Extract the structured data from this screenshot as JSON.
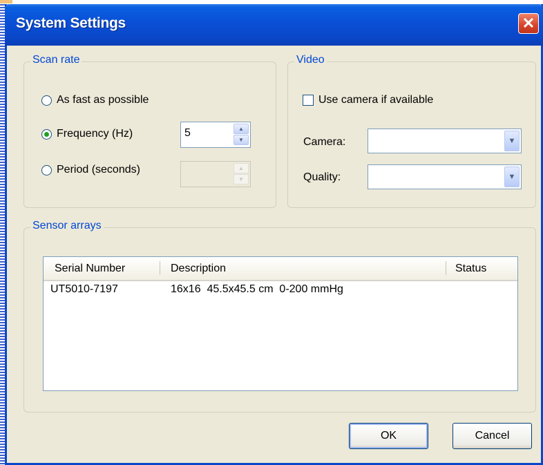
{
  "window": {
    "title": "System Settings",
    "close_glyph": "✕"
  },
  "scan_rate": {
    "legend": "Scan rate",
    "options": [
      {
        "label": "As fast as possible",
        "selected": false
      },
      {
        "label": "Frequency (Hz)",
        "selected": true,
        "value": "5"
      },
      {
        "label": "Period (seconds)",
        "selected": false,
        "value": ""
      }
    ]
  },
  "video": {
    "legend": "Video",
    "use_camera_label": "Use camera if available",
    "use_camera_checked": false,
    "camera_label": "Camera:",
    "camera_value": "",
    "quality_label": "Quality:",
    "quality_value": ""
  },
  "sensor_arrays": {
    "legend": "Sensor arrays",
    "columns": [
      "Serial Number",
      "Description",
      "Status"
    ],
    "rows": [
      {
        "serial": "UT5010-7197",
        "description": "16x16  45.5x45.5 cm  0-200 mmHg",
        "status": ""
      }
    ]
  },
  "buttons": {
    "ok": "OK",
    "cancel": "Cancel"
  },
  "icons": {
    "spin_up": "▲",
    "spin_down": "▼",
    "dropdown": "▼"
  },
  "colors": {
    "title_bar": "#0a47c8",
    "dialog_bg": "#ece9d8",
    "legend_text": "#0046d5",
    "close_button": "#d6442a"
  }
}
